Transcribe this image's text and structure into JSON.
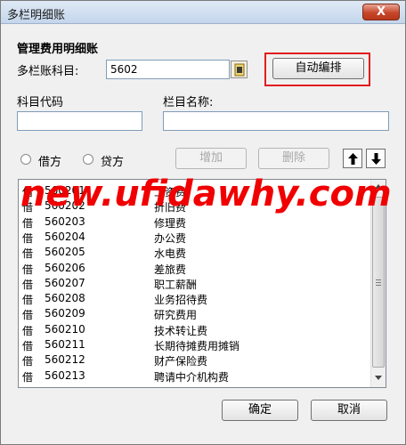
{
  "window": {
    "title": "多栏明细账",
    "close_label": "X"
  },
  "form": {
    "section_title": "管理费用明细账",
    "account_label": "多栏账科目:",
    "account_value": "5602",
    "auto_arrange_label": "自动编排",
    "code_label": "科目代码",
    "code_value": "",
    "column_name_label": "栏目名称:",
    "column_name_value": ""
  },
  "direction": {
    "debit_label": "借方",
    "credit_label": "贷方"
  },
  "actions": {
    "add_label": "增加",
    "delete_label": "删除",
    "ok_label": "确定",
    "cancel_label": "取消"
  },
  "list": {
    "rows": [
      {
        "dir": "借",
        "code": "560201",
        "name": "工资费"
      },
      {
        "dir": "借",
        "code": "560202",
        "name": "折旧费"
      },
      {
        "dir": "借",
        "code": "560203",
        "name": "修理费"
      },
      {
        "dir": "借",
        "code": "560204",
        "name": "办公费"
      },
      {
        "dir": "借",
        "code": "560205",
        "name": "水电费"
      },
      {
        "dir": "借",
        "code": "560206",
        "name": "差旅费"
      },
      {
        "dir": "借",
        "code": "560207",
        "name": "职工薪酬"
      },
      {
        "dir": "借",
        "code": "560208",
        "name": "业务招待费"
      },
      {
        "dir": "借",
        "code": "560209",
        "name": "研究费用"
      },
      {
        "dir": "借",
        "code": "560210",
        "name": "技术转让费"
      },
      {
        "dir": "借",
        "code": "560211",
        "name": "长期待摊费用摊销"
      },
      {
        "dir": "借",
        "code": "560212",
        "name": "财产保险费"
      },
      {
        "dir": "借",
        "code": "560213",
        "name": "聘请中介机构费"
      }
    ]
  },
  "watermark": {
    "text": "new.ufidawhy.com"
  },
  "colors": {
    "highlight": "#e41c1c",
    "watermark": "#f00000",
    "close": "#c7472a"
  },
  "icons": {
    "pick": "picker-icon",
    "up": "arrow-up-icon",
    "down": "arrow-down-icon",
    "scroll_up": "scroll-up-icon",
    "scroll_down": "scroll-down-icon"
  }
}
